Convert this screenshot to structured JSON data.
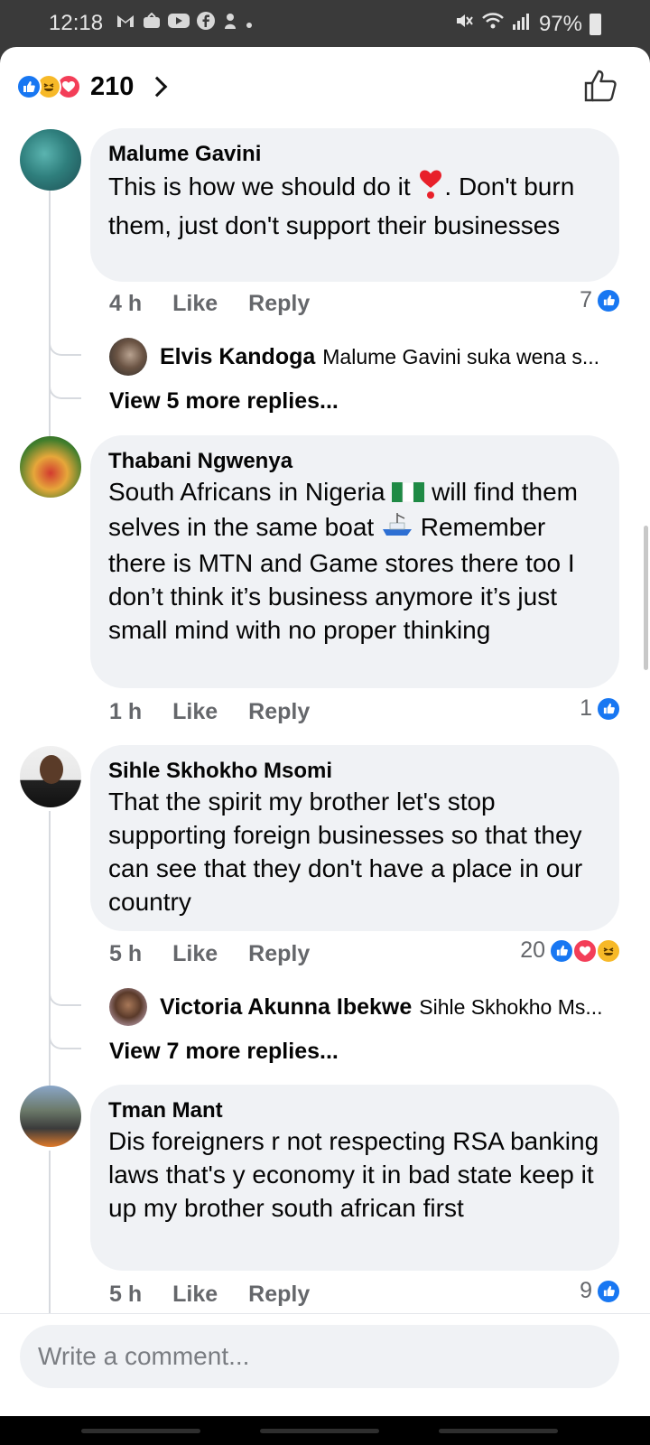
{
  "status_bar": {
    "time": "12:18",
    "left_icons": [
      "gmail-icon",
      "app-icon",
      "youtube-icon",
      "facebook-icon",
      "app-icon",
      "dot-icon"
    ],
    "battery": "97%"
  },
  "header": {
    "reactions": [
      "like",
      "haha",
      "love"
    ],
    "reaction_count": "210"
  },
  "comments": [
    {
      "author": "Malume Gavini",
      "text_before_emoji": "This is how we should do it ",
      "emoji": "❣️",
      "text_after_emoji": ". Don't burn them, just don't support their businesses",
      "time": "4 h",
      "like_label": "Like",
      "reply_label": "Reply",
      "reaction_count": "7",
      "reply_preview": {
        "author": "Elvis Kandoga",
        "snippet": "Malume Gavini suka wena  s..."
      },
      "view_more": "View 5 more replies..."
    },
    {
      "author": "Thabani Ngwenya",
      "text_before_emoji": "South Africans in Nigeria ",
      "emoji": "🇳🇬",
      "text_after_emoji": " will find them selves in the same boat ",
      "emoji2": "🛥️",
      "text_end": " Remember there is MTN and Game stores there too I don’t think it’s business anymore it’s just small mind with no proper thinking",
      "time": "1 h",
      "like_label": "Like",
      "reply_label": "Reply",
      "reaction_count": "1"
    },
    {
      "author": "Sihle Skhokho Msomi",
      "text": "That the spirit my brother let's stop supporting foreign businesses so that they can see that they don't have a place in our country",
      "time": "5 h",
      "like_label": "Like",
      "reply_label": "Reply",
      "reaction_count": "20",
      "reply_preview": {
        "author": "Victoria Akunna Ibekwe",
        "snippet": "Sihle Skhokho Ms..."
      },
      "view_more": "View 7 more replies..."
    },
    {
      "author": "Tman Mant",
      "text": "Dis foreigners r not respecting RSA banking laws that's y economy it in bad state keep it up my brother south african first",
      "time": "5 h",
      "like_label": "Like",
      "reply_label": "Reply",
      "reaction_count": "9"
    }
  ],
  "composer": {
    "placeholder": "Write a comment..."
  },
  "colors": {
    "like_blue": "#1877f2",
    "love_red": "#f33e58",
    "haha_yellow": "#f7b928",
    "bubble_bg": "#f0f2f5",
    "meta_gray": "#65676b"
  }
}
